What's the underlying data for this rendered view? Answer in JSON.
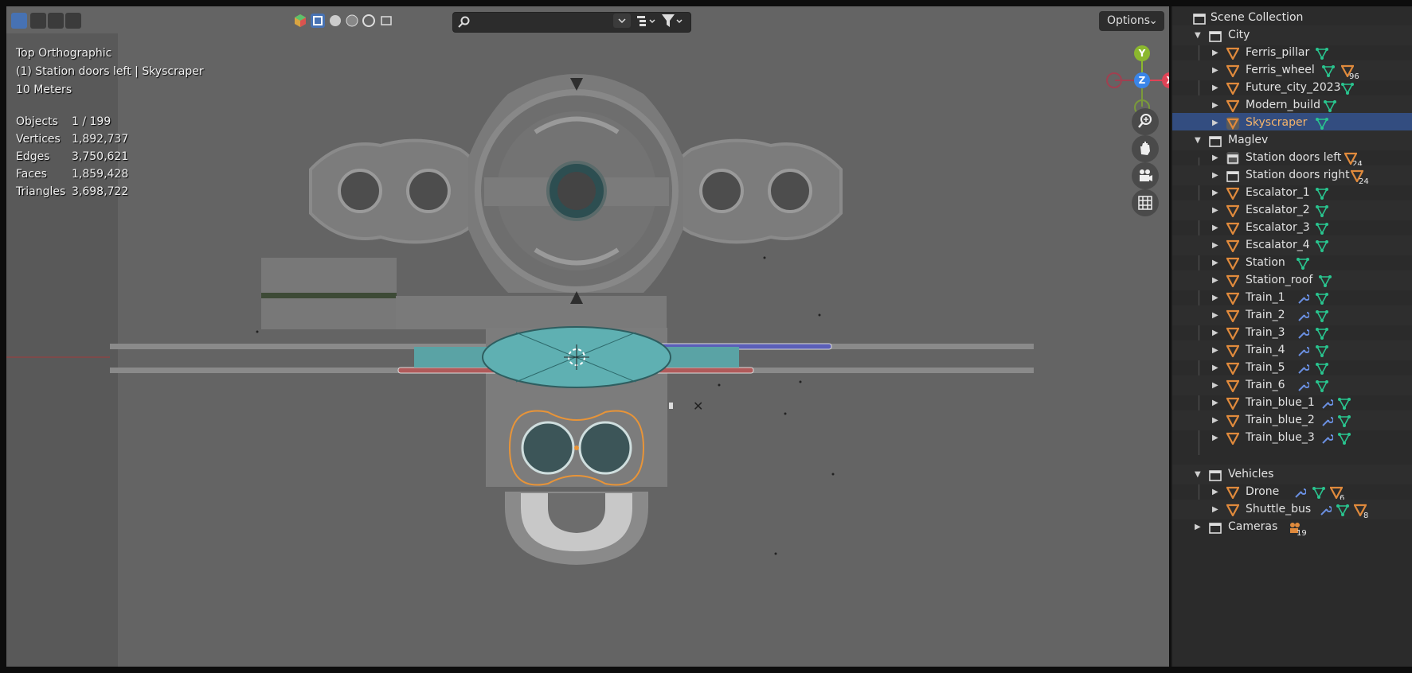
{
  "header": {
    "options_label": "Options",
    "search_placeholder": ""
  },
  "overlay": {
    "view_name": "Top Orthographic",
    "active_object": "(1) Station doors left | Skyscraper",
    "grid_scale": "10 Meters"
  },
  "stats": [
    {
      "label": "Objects",
      "value": "1 / 199"
    },
    {
      "label": "Vertices",
      "value": "1,892,737"
    },
    {
      "label": "Edges",
      "value": "3,750,621"
    },
    {
      "label": "Faces",
      "value": "1,859,428"
    },
    {
      "label": "Triangles",
      "value": "3,698,722"
    }
  ],
  "gizmo": {
    "x": "X",
    "y": "Y",
    "z": "Z"
  },
  "outliner": {
    "root": "Scene Collection",
    "collections": {
      "city": "City",
      "maglev": "Maglev",
      "vehicles": "Vehicles",
      "cameras": "Cameras"
    },
    "city_items": [
      "Ferris_pillar",
      "Ferris_wheel",
      "Future_city_2023",
      "Modern_build",
      "Skyscraper"
    ],
    "maglev_items": [
      "Station doors left",
      "Station doors right",
      "Escalator_1",
      "Escalator_2",
      "Escalator_3",
      "Escalator_4",
      "Station",
      "Station_roof",
      "Train_1",
      "Train_2",
      "Train_3",
      "Train_4",
      "Train_5",
      "Train_6",
      "Train_blue_1",
      "Train_blue_2",
      "Train_blue_3"
    ],
    "vehicle_items": [
      "Drone",
      "Shuttle_bus"
    ],
    "badges": {
      "ferris_wheel": "96",
      "doors_left": "24",
      "doors_right": "24",
      "drone": "6",
      "shuttle_bus": "8",
      "cameras": "19"
    }
  },
  "colors": {
    "selection": "#334d80",
    "selected_text": "#f6b56b",
    "mesh_icon": "#e08a3c",
    "data_icon": "#29c58f",
    "modifier_icon": "#6a8fe0",
    "axis_x": "#e04356",
    "axis_y": "#8bb82e",
    "axis_z": "#3a85e8"
  }
}
